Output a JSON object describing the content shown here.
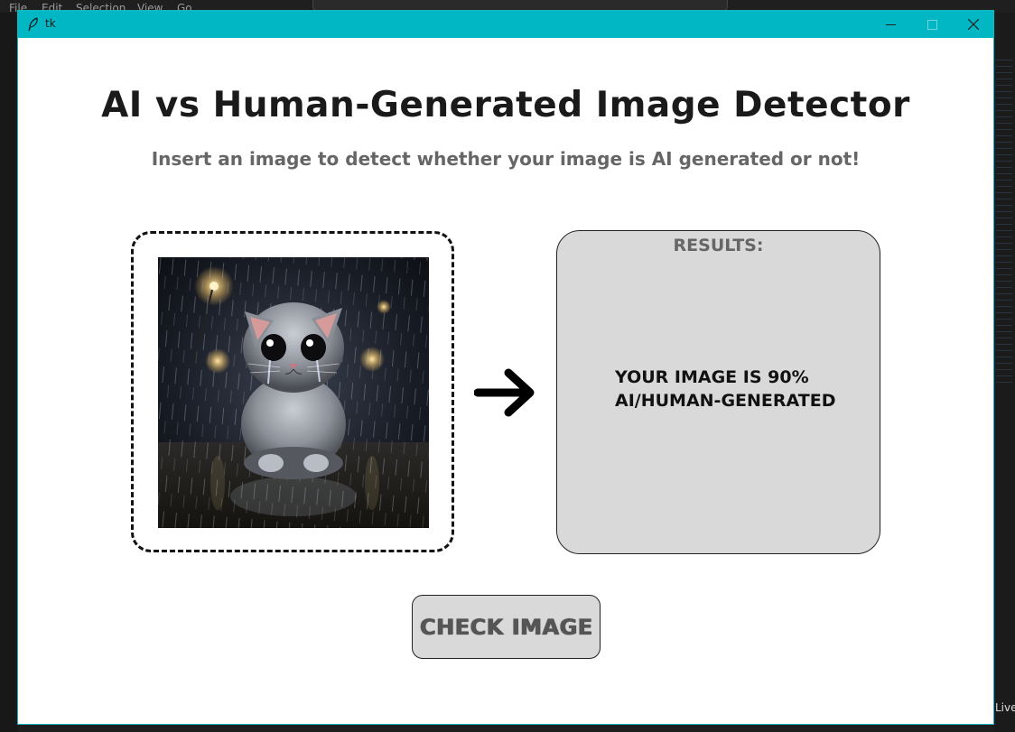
{
  "window": {
    "title": "tk"
  },
  "app": {
    "title": "AI vs Human-Generated Image Detector",
    "subtitle": "Insert an image to detect whether your image is AI generated or not!",
    "results_heading": "RESULTS:",
    "results_line1": "YOUR IMAGE IS 90%",
    "results_line2": "AI/HUMAN-GENERATED",
    "check_button_label": "CHECK IMAGE"
  },
  "background": {
    "menu": [
      "File",
      "Edit",
      "Selection",
      "View",
      "Go"
    ],
    "status_live": "Live"
  },
  "colors": {
    "titlebar": "#00b7c3",
    "panel": "#d9d9d9",
    "title_text": "#1a1a1a",
    "subtitle_text": "#666666"
  },
  "icons": {
    "window": "feather-icon",
    "minimize": "minimize-icon",
    "maximize": "maximize-icon",
    "close": "close-icon",
    "arrow": "arrow-right-icon"
  }
}
